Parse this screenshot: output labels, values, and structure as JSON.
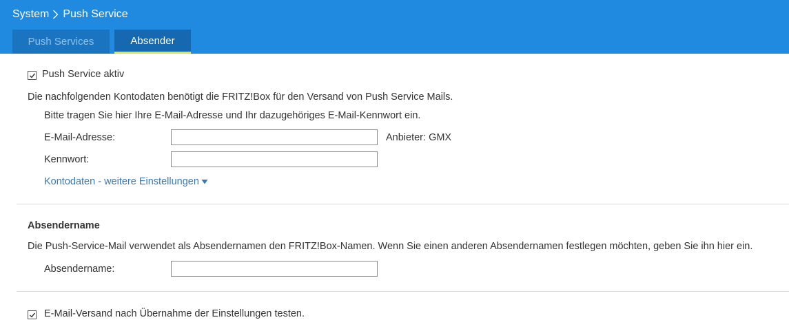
{
  "breadcrumb": {
    "root": "System",
    "current": "Push Service",
    "separator_icon": "chevron-right-icon"
  },
  "tabs": [
    {
      "label": "Push Services",
      "active": false
    },
    {
      "label": "Absender",
      "active": true
    }
  ],
  "account": {
    "active_checkbox_label": "Push Service aktiv",
    "active_checked": true,
    "intro": "Die nachfolgenden Kontodaten benötigt die FRITZ!Box für den Versand von Push Service Mails.",
    "instruction": "Bitte tragen Sie hier Ihre E-Mail-Adresse und Ihr dazugehöriges E-Mail-Kennwort ein.",
    "email_label": "E-Mail-Adresse:",
    "email_value": "",
    "provider": "Anbieter: GMX",
    "password_label": "Kennwort:",
    "password_value": "",
    "more_settings_link": "Kontodaten - weitere Einstellungen"
  },
  "sender": {
    "heading": "Absendername",
    "description": "Die Push-Service-Mail verwendet als Absendernamen den FRITZ!Box-Namen. Wenn Sie einen anderen Absendernamen festlegen möchten, geben Sie ihn hier ein.",
    "name_label": "Absendername:",
    "name_value": ""
  },
  "test": {
    "checkbox_label": "E-Mail-Versand nach Übernahme der Einstellungen testen.",
    "checked": true
  },
  "colors": {
    "header": "#1f8ae0",
    "active_tab_underline": "#d6e94a",
    "link": "#3a7ab8"
  }
}
